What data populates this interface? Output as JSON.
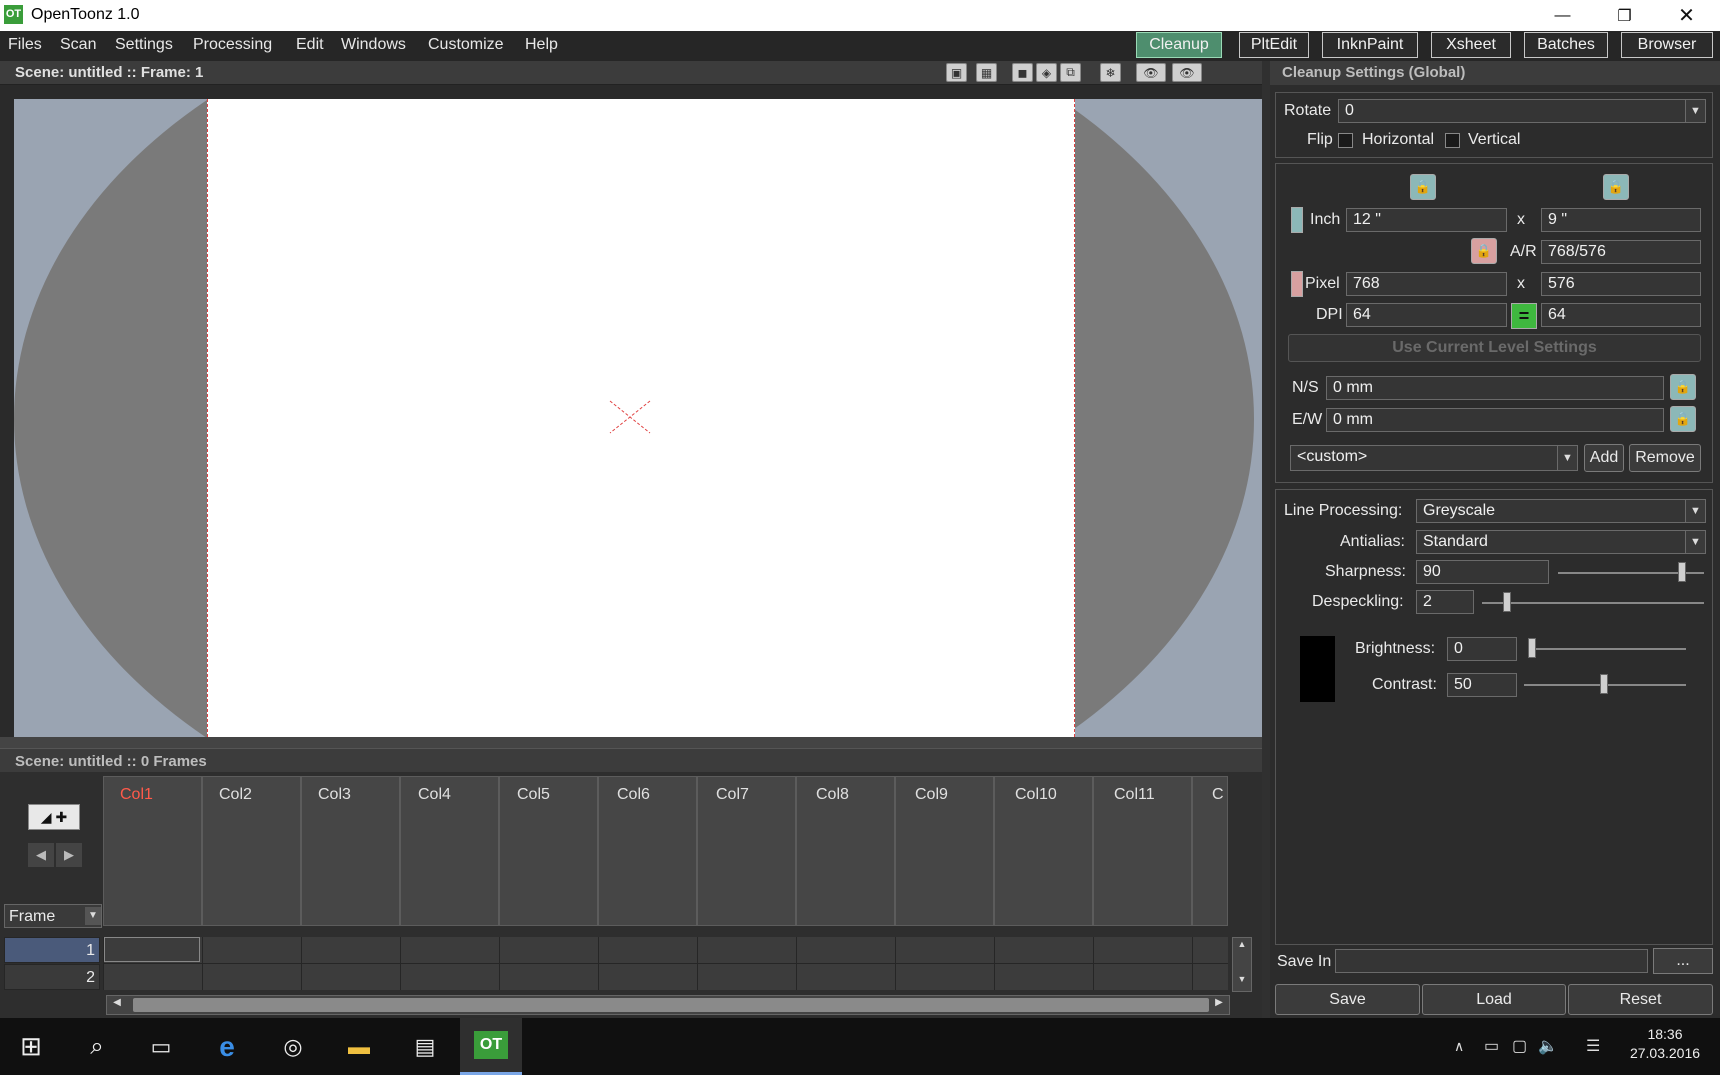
{
  "window": {
    "title": "OpenToonz 1.0",
    "app_icon_text": "OT"
  },
  "menu": [
    "Files",
    "Scan",
    "Settings",
    "Processing",
    "Edit",
    "Windows",
    "Customize",
    "Help"
  ],
  "rooms": [
    "Cleanup",
    "PltEdit",
    "InknPaint",
    "Xsheet",
    "Batches",
    "Browser"
  ],
  "active_room": "Cleanup",
  "viewer": {
    "title": "Scene: untitled  ::  Frame: 1"
  },
  "xsheet": {
    "title": "Scene: untitled  ::  0 Frames",
    "columns": [
      "Col1",
      "Col2",
      "Col3",
      "Col4",
      "Col5",
      "Col6",
      "Col7",
      "Col8",
      "Col9",
      "Col10",
      "Col11",
      "C"
    ],
    "frame_label": "Frame",
    "rows": [
      "1",
      "2"
    ]
  },
  "cleanup": {
    "title": "Cleanup Settings (Global)",
    "rotate_label": "Rotate",
    "rotate_value": "0",
    "flip_label": "Flip",
    "horizontal_label": "Horizontal",
    "vertical_label": "Vertical",
    "inch_label": "Inch",
    "inch_w": "12 \"",
    "inch_h": "9 \"",
    "x": "x",
    "ar_label": "A/R",
    "ar_value": "768/576",
    "pixel_label": "Pixel",
    "pixel_w": "768",
    "pixel_h": "576",
    "dpi_label": "DPI",
    "dpi_x": "64",
    "dpi_y": "64",
    "use_current_label": "Use Current Level Settings",
    "ns_label": "N/S",
    "ns_value": "0 mm",
    "ew_label": "E/W",
    "ew_value": "0 mm",
    "preset_value": "<custom>",
    "add_label": "Add",
    "remove_label": "Remove",
    "line_processing_label": "Line Processing:",
    "line_processing_value": "Greyscale",
    "antialias_label": "Antialias:",
    "antialias_value": "Standard",
    "sharpness_label": "Sharpness:",
    "sharpness_value": "90",
    "despeckling_label": "Despeckling:",
    "despeckling_value": "2",
    "brightness_label": "Brightness:",
    "brightness_value": "0",
    "contrast_label": "Contrast:",
    "contrast_value": "50",
    "save_in_label": "Save In",
    "save_in_value": "",
    "browse_label": "...",
    "save_label": "Save",
    "load_label": "Load",
    "reset_label": "Reset"
  },
  "taskbar": {
    "time": "18:36",
    "date": "27.03.2016"
  },
  "colors": {
    "accent_room": "#4e8e6e",
    "active_column": "#ff5a4a",
    "paper_border": "#e04040"
  }
}
